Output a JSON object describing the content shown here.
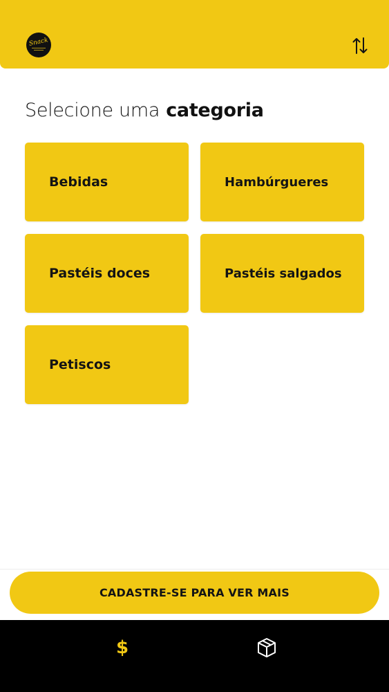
{
  "colors": {
    "brand": "#f1c814",
    "text": "#141414",
    "background": "#ffffff",
    "nav_background": "#000000",
    "nav_inactive_icon": "#ffffff"
  },
  "header": {
    "logo_icon": "restaurant-logo",
    "sort_icon": "sort-arrows-icon"
  },
  "main": {
    "title_light": "Selecione uma",
    "title_bold": "categoria",
    "categories": [
      {
        "label": "Bebidas"
      },
      {
        "label": "Hambúrgueres"
      },
      {
        "label": "Pastéis doces"
      },
      {
        "label": "Pastéis salgados"
      },
      {
        "label": "Petiscos"
      }
    ]
  },
  "cta": {
    "label": "CADASTRE-SE PARA VER MAIS"
  },
  "bottom_nav": {
    "items": [
      {
        "icon": "dollar-icon",
        "glyph": "$",
        "active": true
      },
      {
        "icon": "package-box-icon",
        "active": false
      }
    ]
  }
}
